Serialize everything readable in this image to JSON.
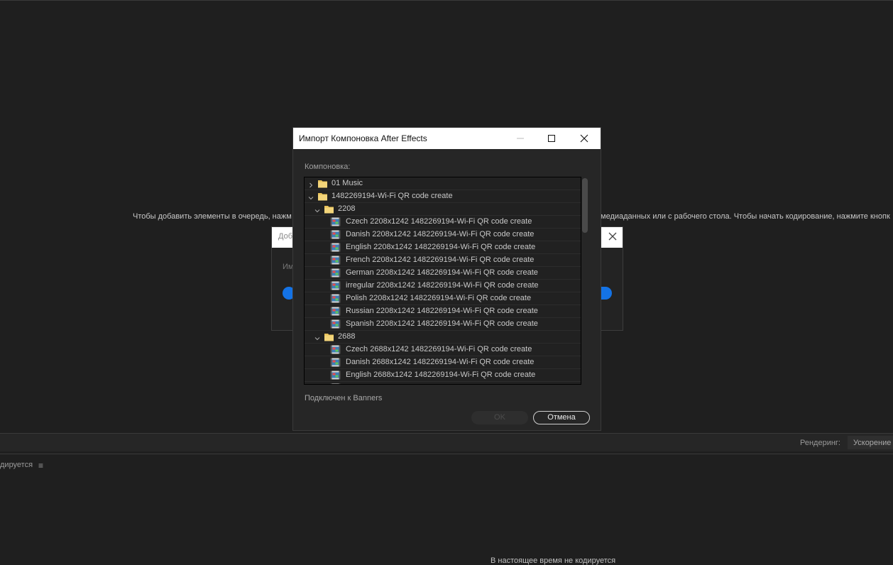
{
  "background": {
    "hint_left": "Чтобы добавить элементы в очередь, нажм",
    "hint_right": "медиаданных или с рабочего стола. Чтобы начать кодирование, нажмите кнопк",
    "dialog_title_fragment": "Доб",
    "dialog_text_fragment": "Им",
    "render_label": "Рендеринг:",
    "render_value": "Ускорение",
    "queue_fragment": "дируется",
    "bottom_fragment": "В настоящее время не кодируется"
  },
  "dialog": {
    "title": "Импорт Компоновка After Effects",
    "section_label": "Компоновка:",
    "status": "Подключен к Banners",
    "ok_label": "OK",
    "cancel_label": "Отмена",
    "tree": [
      {
        "label": "01 Music",
        "type": "folder",
        "level": 0,
        "expanded": false
      },
      {
        "label": "1482269194-Wi-Fi QR code create",
        "type": "folder",
        "level": 0,
        "expanded": true
      },
      {
        "label": "2208",
        "type": "folder",
        "level": 1,
        "expanded": true
      },
      {
        "label": "Czech 2208x1242 1482269194-Wi-Fi QR code create",
        "type": "comp",
        "level": 2
      },
      {
        "label": "Danish 2208x1242 1482269194-Wi-Fi QR code create",
        "type": "comp",
        "level": 2
      },
      {
        "label": "English 2208x1242 1482269194-Wi-Fi QR code create",
        "type": "comp",
        "level": 2
      },
      {
        "label": "French 2208x1242 1482269194-Wi-Fi QR code create",
        "type": "comp",
        "level": 2
      },
      {
        "label": "German 2208x1242 1482269194-Wi-Fi QR code create",
        "type": "comp",
        "level": 2
      },
      {
        "label": "irregular 2208x1242 1482269194-Wi-Fi QR code create",
        "type": "comp",
        "level": 2
      },
      {
        "label": "Polish 2208x1242 1482269194-Wi-Fi QR code create",
        "type": "comp",
        "level": 2
      },
      {
        "label": "Russian 2208x1242 1482269194-Wi-Fi QR code create",
        "type": "comp",
        "level": 2
      },
      {
        "label": "Spanish 2208x1242 1482269194-Wi-Fi QR code create",
        "type": "comp",
        "level": 2
      },
      {
        "label": "2688",
        "type": "folder",
        "level": 1,
        "expanded": true
      },
      {
        "label": "Czech 2688x1242 1482269194-Wi-Fi QR code create",
        "type": "comp",
        "level": 2
      },
      {
        "label": "Danish 2688x1242 1482269194-Wi-Fi QR code create",
        "type": "comp",
        "level": 2
      },
      {
        "label": "English 2688x1242 1482269194-Wi-Fi QR code create",
        "type": "comp",
        "level": 2
      },
      {
        "label": "",
        "type": "comp",
        "level": 2
      }
    ]
  },
  "icons": {
    "folder": "folder-icon",
    "comp": "composition-icon",
    "collapsed": "chevron-right-icon",
    "expanded": "chevron-down-icon"
  },
  "colors": {
    "accent_blue": "#1473e6",
    "folder_yellow": "#e8c25a",
    "background": "#1f1f1f",
    "dialog_bg": "#262626"
  }
}
